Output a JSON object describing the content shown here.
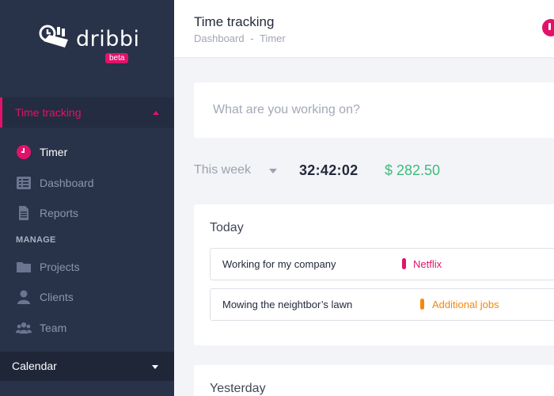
{
  "app": {
    "logo_text": "dribbi",
    "beta_label": "beta"
  },
  "sidebar": {
    "section_label": "Time tracking",
    "items": [
      {
        "label": "Timer",
        "icon": "clock-icon",
        "active": true
      },
      {
        "label": "Dashboard",
        "icon": "list-icon",
        "active": false
      },
      {
        "label": "Reports",
        "icon": "document-icon",
        "active": false
      }
    ],
    "manage_label": "MANAGE",
    "manage_items": [
      {
        "label": "Projects",
        "icon": "folder-icon"
      },
      {
        "label": "Clients",
        "icon": "user-icon"
      },
      {
        "label": "Team",
        "icon": "users-icon"
      }
    ],
    "calendar_label": "Calendar"
  },
  "header": {
    "title": "Time tracking",
    "breadcrumb": [
      "Dashboard",
      "-",
      "Timer"
    ]
  },
  "timer_input": {
    "placeholder": "What are you working on?",
    "value": ""
  },
  "summary": {
    "period": "This week",
    "total_time": "32:42:02",
    "amount": "$ 282.50"
  },
  "days": [
    {
      "title": "Today",
      "entries": [
        {
          "description": "Working for my company",
          "project": "Netflix",
          "project_color": "#e2126a"
        },
        {
          "description": "Mowing the neightbor’s lawn",
          "project": "Additional jobs",
          "project_color": "#f5870c"
        }
      ]
    },
    {
      "title": "Yesterday",
      "entries": []
    }
  ],
  "colors": {
    "accent": "#e2126a",
    "sidebar_bg": "#283248",
    "money": "#3dbb7a"
  }
}
